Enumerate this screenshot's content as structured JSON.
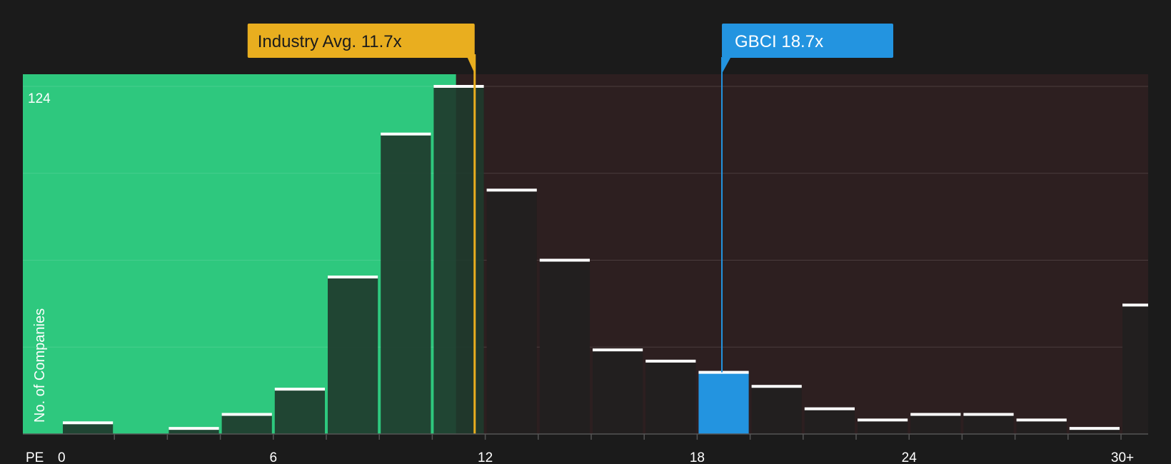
{
  "chart_data": {
    "type": "bar",
    "title": "",
    "xlabel": "PE",
    "ylabel": "No. of Companies",
    "y_max_label": "124",
    "ylim": [
      0,
      124
    ],
    "xlim": [
      0,
      30
    ],
    "x_ticks": [
      {
        "value": 0,
        "label": "0"
      },
      {
        "value": 6,
        "label": "6"
      },
      {
        "value": 12,
        "label": "12"
      },
      {
        "value": 18,
        "label": "18"
      },
      {
        "value": 24,
        "label": "24"
      },
      {
        "value": 30,
        "label": "30+"
      }
    ],
    "bins": [
      {
        "start": 0,
        "end": 1.5,
        "value": 4
      },
      {
        "start": 1.5,
        "end": 3.0,
        "value": 0
      },
      {
        "start": 3.0,
        "end": 4.5,
        "value": 2
      },
      {
        "start": 4.5,
        "end": 6.0,
        "value": 7
      },
      {
        "start": 6.0,
        "end": 7.5,
        "value": 16
      },
      {
        "start": 7.5,
        "end": 9.0,
        "value": 56
      },
      {
        "start": 9.0,
        "end": 10.5,
        "value": 107
      },
      {
        "start": 10.5,
        "end": 12.0,
        "value": 124
      },
      {
        "start": 12.0,
        "end": 13.5,
        "value": 87
      },
      {
        "start": 13.5,
        "end": 15.0,
        "value": 62
      },
      {
        "start": 15.0,
        "end": 16.5,
        "value": 30
      },
      {
        "start": 16.5,
        "end": 18.0,
        "value": 26
      },
      {
        "start": 18.0,
        "end": 19.5,
        "value": 22
      },
      {
        "start": 19.5,
        "end": 21.0,
        "value": 17
      },
      {
        "start": 21.0,
        "end": 22.5,
        "value": 9
      },
      {
        "start": 22.5,
        "end": 24.0,
        "value": 5
      },
      {
        "start": 24.0,
        "end": 25.5,
        "value": 7
      },
      {
        "start": 25.5,
        "end": 27.0,
        "value": 7
      },
      {
        "start": 27.0,
        "end": 28.5,
        "value": 5
      },
      {
        "start": 28.5,
        "end": 30.0,
        "value": 2
      },
      {
        "start": 30.0,
        "end": 31.5,
        "value": 46
      }
    ],
    "industry_avg": {
      "value": 11.7,
      "label": "Industry Avg. 11.7x",
      "color": "#e9ae1f"
    },
    "company": {
      "value": 18.7,
      "label": "GBCI 18.7x",
      "color": "#2394e0"
    },
    "highlight_bin_start": 18.0,
    "colors": {
      "below_region": "#2ec87e",
      "above_region": "#2d1f20",
      "bar_below": "#1f3a2d",
      "bar_above": "#221f1f",
      "bar_cap": "#ffffff",
      "gridline": "#4a3d3d",
      "background": "#1b1b1b"
    },
    "grid": true,
    "legend": "none"
  }
}
